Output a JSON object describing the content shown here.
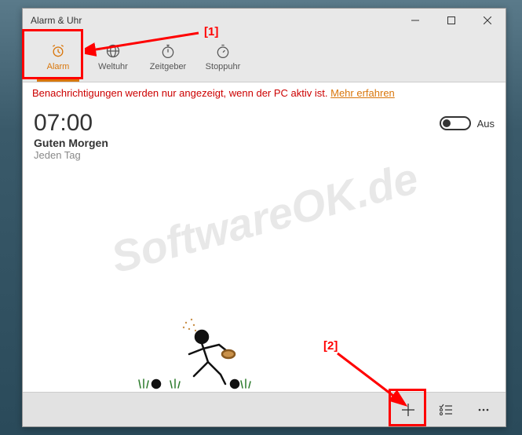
{
  "window": {
    "title": "Alarm & Uhr"
  },
  "tabs": {
    "alarm": "Alarm",
    "worldclock": "Weltuhr",
    "timer": "Zeitgeber",
    "stopwatch": "Stoppuhr"
  },
  "banner": {
    "text": "Benachrichtigungen werden nur angezeigt, wenn der PC aktiv ist. ",
    "link": "Mehr erfahren"
  },
  "alarm": {
    "time": "07:00",
    "name": "Guten Morgen",
    "repeat": "Jeden Tag",
    "toggle_state": "Aus"
  },
  "annotations": {
    "label1": "[1]",
    "label2": "[2]"
  },
  "watermark": "SoftwareOK.de"
}
